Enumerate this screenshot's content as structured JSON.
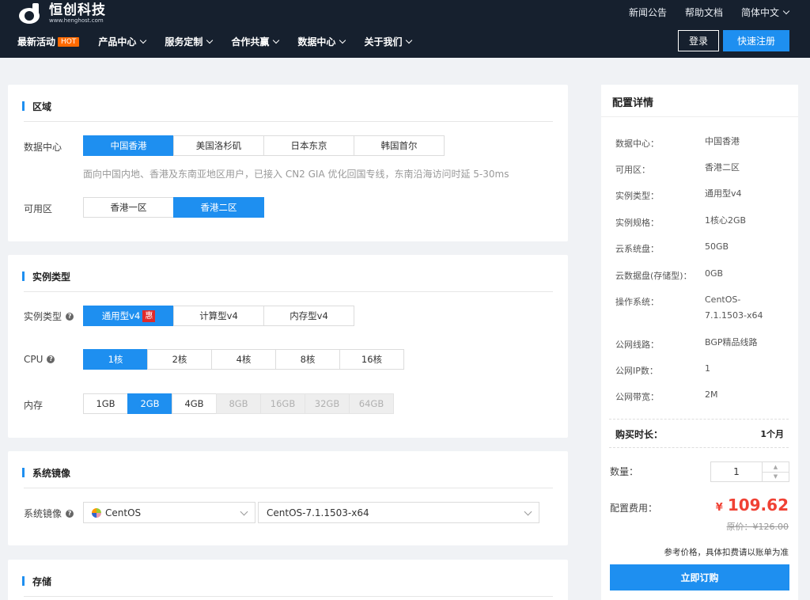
{
  "brand": {
    "name": "恒创科技",
    "domain": "www.henghost.com"
  },
  "top_links": [
    "新闻公告",
    "帮助文档",
    "简体中文"
  ],
  "nav": [
    {
      "label": "最新活动",
      "badge": "HOT"
    },
    {
      "label": "产品中心"
    },
    {
      "label": "服务定制"
    },
    {
      "label": "合作共赢"
    },
    {
      "label": "数据中心"
    },
    {
      "label": "关于我们"
    }
  ],
  "auth": {
    "login": "登录",
    "register": "快速注册"
  },
  "region": {
    "title": "区域",
    "datacenter_label": "数据中心",
    "datacenters": [
      "中国香港",
      "美国洛杉矶",
      "日本东京",
      "韩国首尔"
    ],
    "datacenter_selected": "中国香港",
    "note": "面向中国内地、香港及东南亚地区用户，已接入 CN2 GIA 优化回国专线，东南沿海访问时延 5-30ms",
    "zone_label": "可用区",
    "zones": [
      "香港一区",
      "香港二区"
    ],
    "zone_selected": "香港二区"
  },
  "instance": {
    "title": "实例类型",
    "type_label": "实例类型",
    "types": [
      "通用型v4",
      "计算型v4",
      "内存型v4"
    ],
    "type_selected": "通用型v4",
    "type_badge": "惠",
    "cpu_label": "CPU",
    "cpus": [
      "1核",
      "2核",
      "4核",
      "8核",
      "16核"
    ],
    "cpu_selected": "1核",
    "mem_label": "内存",
    "mems": [
      "1GB",
      "2GB",
      "4GB",
      "8GB",
      "16GB",
      "32GB",
      "64GB"
    ],
    "mem_selected": "2GB",
    "mem_disabled": [
      "8GB",
      "16GB",
      "32GB",
      "64GB"
    ]
  },
  "image": {
    "title": "系统镜像",
    "label": "系统镜像",
    "os": "CentOS",
    "version": "CentOS-7.1.1503-x64"
  },
  "storage": {
    "title": "存储"
  },
  "summary": {
    "title": "配置详情",
    "specs": [
      {
        "k": "数据中心：",
        "v": "中国香港"
      },
      {
        "k": "可用区：",
        "v": "香港二区"
      },
      {
        "k": "实例类型：",
        "v": "通用型v4"
      },
      {
        "k": "实例规格：",
        "v": "1核心2GB"
      },
      {
        "k": "云系统盘：",
        "v": "50GB"
      },
      {
        "k": "云数据盘(存储型)：",
        "v": "0GB"
      },
      {
        "k": "操作系统：",
        "v": "CentOS-7.1.1503-x64"
      },
      {
        "k": "公网线路：",
        "v": "BGP精品线路"
      },
      {
        "k": "公网IP数：",
        "v": "1"
      },
      {
        "k": "公网带宽：",
        "v": "2M"
      }
    ],
    "duration_label": "购买时长：",
    "duration_value": "1个月",
    "qty_label": "数量：",
    "qty_value": "1",
    "fee_label": "配置费用：",
    "currency": "¥",
    "price": "109.62",
    "original_price": "原价：¥126.00",
    "reference": "参考价格，具体扣费请以账单为准",
    "order_button": "立即订购"
  },
  "colors": {
    "accent": "#1e8ff0",
    "header_bg": "#16202e",
    "price": "#f04134",
    "hot": "#ff6a00"
  }
}
